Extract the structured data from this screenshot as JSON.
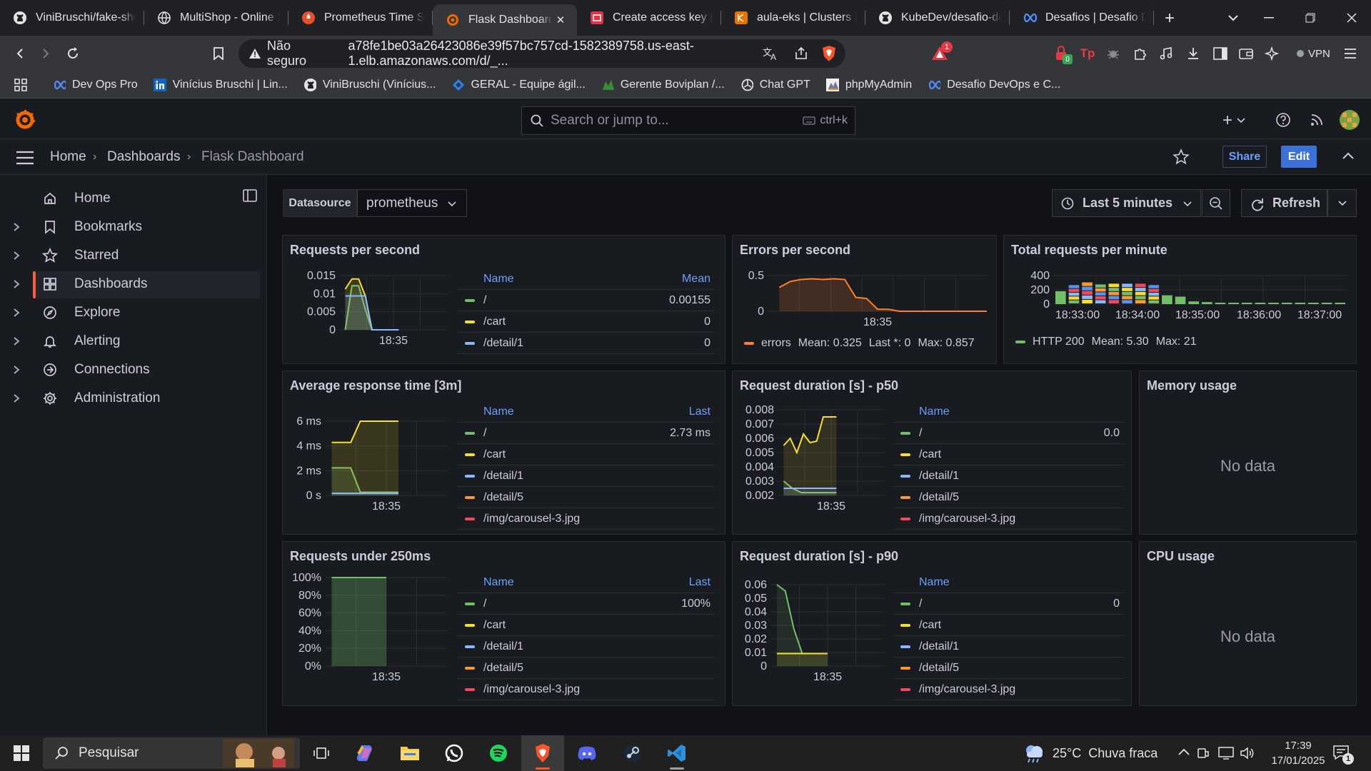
{
  "browser": {
    "tabs": [
      {
        "label": "ViniBruschi/fake-shop",
        "icon": "github-icon"
      },
      {
        "label": "MultiShop - Online Shop",
        "icon": "globe-icon"
      },
      {
        "label": "Prometheus Time Series",
        "icon": "prometheus-icon"
      },
      {
        "label": "Flask Dashboard - Dashboards",
        "icon": "grafana-icon",
        "active": true
      },
      {
        "label": "Create access key | IAM",
        "icon": "aws-iam-icon"
      },
      {
        "label": "aula-eks | Clusters | EKS",
        "icon": "aws-eks-icon"
      },
      {
        "label": "KubeDev/desafio-devops",
        "icon": "github-icon"
      },
      {
        "label": "Desafios | Desafio DevOps",
        "icon": "devops-icon"
      }
    ],
    "address": {
      "security": "Não seguro",
      "url": "a78fe1be03a26423086e39f57bc757cd-1582389758.us-east-1.elb.amazonaws.com/d/_..."
    },
    "brave_badge": "1",
    "ext_badge": "0",
    "vpn_label": "VPN",
    "bookmarks": [
      {
        "label": "Dev Ops Pro",
        "icon": "devops-icon"
      },
      {
        "label": "Vinícius Bruschi | Lin...",
        "icon": "linkedin-icon"
      },
      {
        "label": "ViniBruschi (Vinícius...",
        "icon": "github-icon"
      },
      {
        "label": "GERAL - Equipe ágil...",
        "icon": "jira-icon"
      },
      {
        "label": "Gerente Boviplan /...",
        "icon": "boviplan-icon"
      },
      {
        "label": "Chat GPT",
        "icon": "openai-icon"
      },
      {
        "label": "phpMyAdmin",
        "icon": "phpmyadmin-icon"
      },
      {
        "label": "Desafio DevOps e C...",
        "icon": "devops-icon"
      }
    ]
  },
  "grafana": {
    "search_placeholder": "Search or jump to...",
    "search_shortcut": "ctrl+k",
    "breadcrumb": [
      "Home",
      "Dashboards",
      "Flask Dashboard"
    ],
    "share_label": "Share",
    "edit_label": "Edit",
    "sidebar": [
      {
        "label": "Home",
        "icon": "home-icon",
        "chevron": false
      },
      {
        "label": "Bookmarks",
        "icon": "bookmark-icon",
        "chevron": true
      },
      {
        "label": "Starred",
        "icon": "star-icon",
        "chevron": true
      },
      {
        "label": "Dashboards",
        "icon": "dashboards-icon",
        "chevron": true,
        "active": true
      },
      {
        "label": "Explore",
        "icon": "compass-icon",
        "chevron": true
      },
      {
        "label": "Alerting",
        "icon": "bell-icon",
        "chevron": true
      },
      {
        "label": "Connections",
        "icon": "connections-icon",
        "chevron": true
      },
      {
        "label": "Administration",
        "icon": "gear-icon",
        "chevron": true
      }
    ],
    "datasource_label": "Datasource",
    "datasource_value": "prometheus",
    "time_range": "Last 5 minutes",
    "refresh_label": "Refresh",
    "panels": {
      "rps": {
        "title": "Requests per second",
        "col_name": "Name",
        "col_val": "Mean",
        "rows": [
          {
            "name": "/",
            "val": "0.00155",
            "color": "#73bf69"
          },
          {
            "name": "/cart",
            "val": "0",
            "color": "#fade2a"
          },
          {
            "name": "/detail/1",
            "val": "0",
            "color": "#8ab8ff"
          }
        ]
      },
      "eps": {
        "title": "Errors per second",
        "legend": {
          "name": "errors",
          "mean": "Mean: 0.325",
          "last": "Last *: 0",
          "max": "Max: 0.857"
        }
      },
      "trpm": {
        "title": "Total requests per minute",
        "legend": {
          "name": "HTTP 200",
          "mean": "Mean: 5.30",
          "max": "Max: 21"
        }
      },
      "art": {
        "title": "Average response time [3m]",
        "col_name": "Name",
        "col_val": "Last",
        "rows": [
          {
            "name": "/",
            "val": "2.73 ms",
            "color": "#73bf69"
          },
          {
            "name": "/cart",
            "val": "",
            "color": "#fade2a"
          },
          {
            "name": "/detail/1",
            "val": "",
            "color": "#8ab8ff"
          },
          {
            "name": "/detail/5",
            "val": "",
            "color": "#ff9830"
          },
          {
            "name": "/img/carousel-3.jpg",
            "val": "",
            "color": "#f2495c"
          }
        ]
      },
      "p50": {
        "title": "Request duration [s] - p50",
        "col_name": "Name",
        "rows": [
          {
            "name": "/",
            "val": "0.0",
            "color": "#73bf69"
          },
          {
            "name": "/cart",
            "val": "",
            "color": "#fade2a"
          },
          {
            "name": "/detail/1",
            "val": "",
            "color": "#8ab8ff"
          },
          {
            "name": "/detail/5",
            "val": "",
            "color": "#ff9830"
          },
          {
            "name": "/img/carousel-3.jpg",
            "val": "",
            "color": "#f2495c"
          }
        ]
      },
      "mem": {
        "title": "Memory usage",
        "nodata": "No data"
      },
      "u250": {
        "title": "Requests under 250ms",
        "col_name": "Name",
        "col_val": "Last",
        "rows": [
          {
            "name": "/",
            "val": "100%",
            "color": "#73bf69"
          },
          {
            "name": "/cart",
            "val": "",
            "color": "#fade2a"
          },
          {
            "name": "/detail/1",
            "val": "",
            "color": "#8ab8ff"
          },
          {
            "name": "/detail/5",
            "val": "",
            "color": "#ff9830"
          },
          {
            "name": "/img/carousel-3.jpg",
            "val": "",
            "color": "#f2495c"
          }
        ]
      },
      "p90": {
        "title": "Request duration [s] - p90",
        "col_name": "Name",
        "rows": [
          {
            "name": "/",
            "val": "0",
            "color": "#73bf69"
          },
          {
            "name": "/cart",
            "val": "",
            "color": "#fade2a"
          },
          {
            "name": "/detail/1",
            "val": "",
            "color": "#8ab8ff"
          },
          {
            "name": "/detail/5",
            "val": "",
            "color": "#ff9830"
          },
          {
            "name": "/img/carousel-3.jpg",
            "val": "",
            "color": "#f2495c"
          }
        ]
      },
      "cpu": {
        "title": "CPU usage",
        "nodata": "No data"
      }
    }
  },
  "chart_data": [
    {
      "type": "line",
      "title": "Requests per second",
      "x_ticks": [
        "18:35"
      ],
      "y_ticks": [
        "0",
        "0.005",
        "0.01",
        "0.015"
      ],
      "ylim": [
        0,
        0.016
      ],
      "series": [
        {
          "name": "/",
          "color": "#73bf69",
          "values": [
            0,
            0.013,
            0.013,
            0.006,
            0,
            0,
            0,
            0,
            0
          ]
        },
        {
          "name": "/cart",
          "color": "#fade2a",
          "values": [
            0.012,
            0.015,
            0.015,
            0.01,
            0,
            0,
            0,
            0,
            0
          ]
        },
        {
          "name": "/detail/1",
          "color": "#8ab8ff",
          "values": [
            0.01,
            0.01,
            0.01,
            0.01,
            0,
            0,
            0,
            0,
            0
          ]
        }
      ]
    },
    {
      "type": "area",
      "title": "Errors per second",
      "x_ticks": [
        "18:35"
      ],
      "y_ticks": [
        "0",
        "0.5"
      ],
      "ylim": [
        0,
        0.9
      ],
      "series": [
        {
          "name": "errors",
          "color": "#ff7f2a",
          "values": [
            0.6,
            0.75,
            0.8,
            0.82,
            0.8,
            0.82,
            0.8,
            0.35,
            0.32,
            0.05,
            0.05,
            0,
            0,
            0,
            0,
            0,
            0,
            0,
            0,
            0
          ]
        }
      ]
    },
    {
      "type": "bar",
      "title": "Total requests per minute",
      "x_ticks": [
        "18:33:00",
        "18:34:00",
        "18:35:00",
        "18:36:00",
        "18:37:00"
      ],
      "y_ticks": [
        "0",
        "200",
        "400"
      ],
      "ylim": [
        0,
        420
      ],
      "series": [
        {
          "name": "HTTP 200",
          "color": "#73bf69",
          "values": [
            190,
            280,
            320,
            290,
            300,
            300,
            300,
            280,
            130,
            110,
            40,
            30,
            20,
            15,
            15,
            15,
            15,
            15,
            15,
            15,
            15,
            15
          ]
        }
      ]
    },
    {
      "type": "line",
      "title": "Average response time [3m]",
      "x_ticks": [
        "18:35"
      ],
      "y_ticks": [
        "0 s",
        "2 ms",
        "4 ms",
        "6 ms"
      ],
      "ylim": [
        0,
        7
      ],
      "series": [
        {
          "name": "/",
          "color": "#73bf69",
          "values": [
            2.6,
            2.6,
            2.6,
            0.3,
            0.3,
            0.3,
            0.3,
            0.3
          ]
        },
        {
          "name": "/cart",
          "color": "#fade2a",
          "values": [
            5.0,
            5.0,
            5.0,
            7.0,
            7.0,
            7.0,
            7.0,
            7.0
          ]
        },
        {
          "name": "/detail/1",
          "color": "#8ab8ff",
          "values": [
            0.2,
            0.2,
            0.2,
            0.2,
            0.2,
            0.2,
            0.2,
            0.2
          ]
        }
      ]
    },
    {
      "type": "line",
      "title": "Request duration [s] - p50",
      "x_ticks": [
        "18:35"
      ],
      "y_ticks": [
        "0.002",
        "0.003",
        "0.004",
        "0.005",
        "0.006",
        "0.007",
        "0.008"
      ],
      "ylim": [
        0.002,
        0.008
      ],
      "series": [
        {
          "name": "/",
          "color": "#73bf69",
          "values": [
            0.003,
            0.0025,
            0.0022,
            0.0022,
            0.0022,
            0.0022,
            0.0022
          ]
        },
        {
          "name": "/cart",
          "color": "#fade2a",
          "values": [
            0.0055,
            0.006,
            0.005,
            0.0063,
            0.0057,
            0.0058,
            0.0075,
            0.0075,
            0.0075
          ]
        },
        {
          "name": "/detail/1",
          "color": "#8ab8ff",
          "values": [
            0.0025,
            0.0025,
            0.0025,
            0.0025,
            0.0025,
            0.0025
          ]
        }
      ]
    },
    {
      "type": "area",
      "title": "Requests under 250ms",
      "x_ticks": [
        "18:35"
      ],
      "y_ticks": [
        "0%",
        "20%",
        "40%",
        "60%",
        "80%",
        "100%"
      ],
      "ylim": [
        0,
        100
      ],
      "series": [
        {
          "name": "/",
          "color": "#73bf69",
          "values": [
            100,
            100,
            100,
            100,
            100,
            100,
            100
          ]
        }
      ]
    },
    {
      "type": "line",
      "title": "Request duration [s] - p90",
      "x_ticks": [
        "18:35"
      ],
      "y_ticks": [
        "0",
        "0.01",
        "0.02",
        "0.03",
        "0.04",
        "0.05",
        "0.06"
      ],
      "ylim": [
        0,
        0.065
      ],
      "series": [
        {
          "name": "/",
          "color": "#73bf69",
          "values": [
            0.065,
            0.06,
            0.03,
            0.01,
            0.01,
            0.01,
            0.01
          ]
        },
        {
          "name": "/cart",
          "color": "#fade2a",
          "values": [
            0.01,
            0.01,
            0.01,
            0.01,
            0.01,
            0.01
          ]
        }
      ]
    }
  ],
  "taskbar": {
    "search_placeholder": "Pesquisar",
    "weather": "25°C  Chuva fraca",
    "time": "17:39",
    "date": "17/01/2025",
    "notif_count": "1",
    "apps": [
      "task-view-icon",
      "copilot-icon",
      "file-explorer-icon",
      "whatsapp-icon",
      "spotify-icon",
      "brave-icon",
      "discord-icon",
      "steam-icon",
      "vscode-icon"
    ]
  }
}
